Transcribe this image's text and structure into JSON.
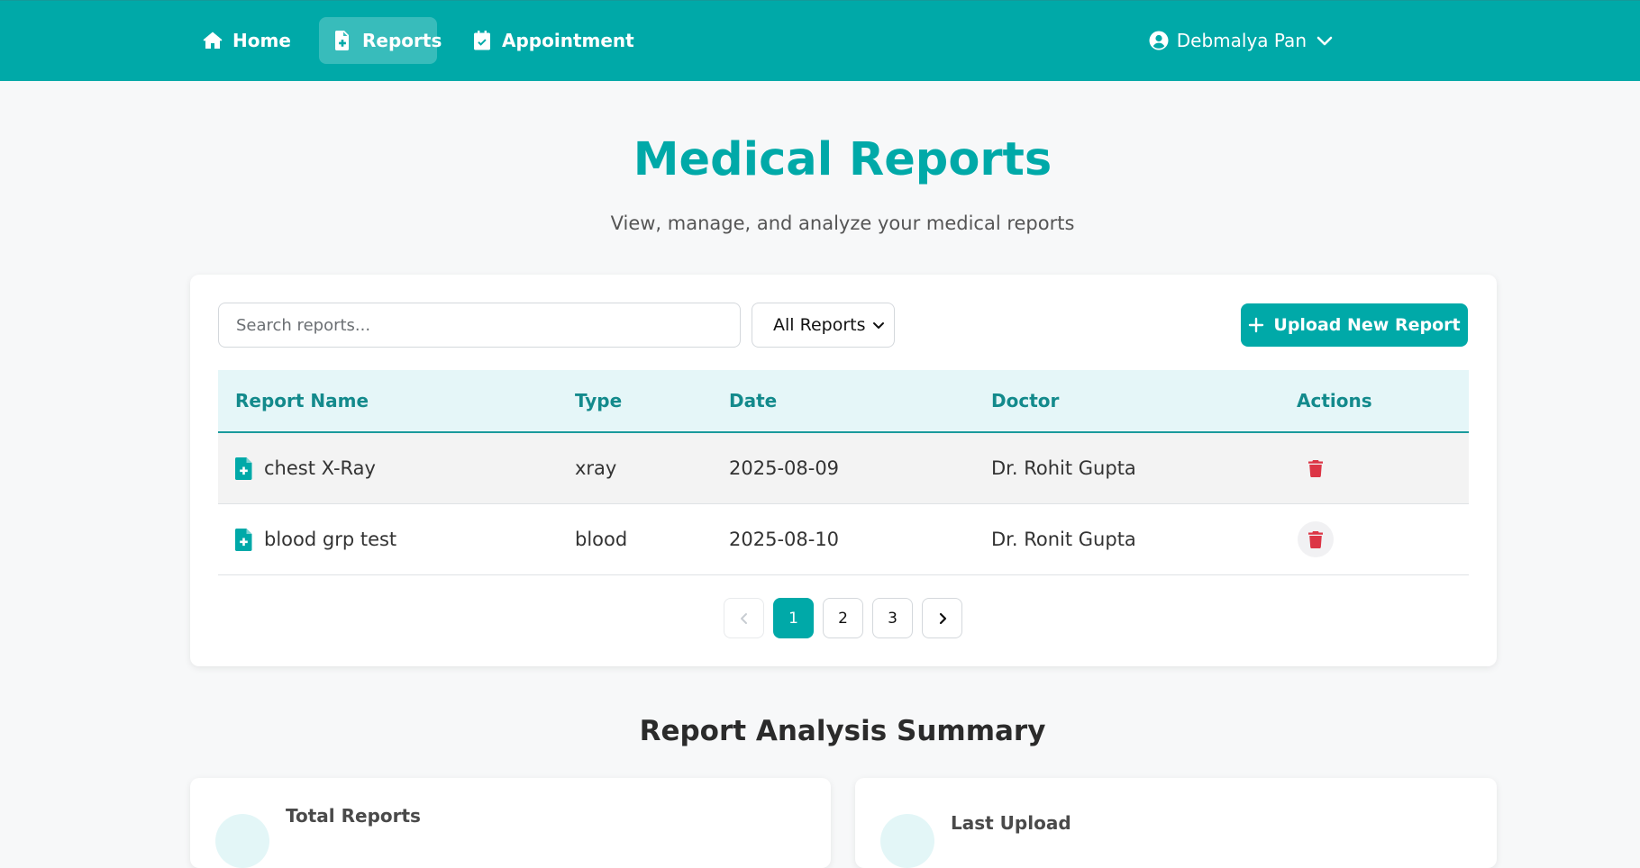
{
  "nav": {
    "items": [
      {
        "label": "Home",
        "icon": "home-icon"
      },
      {
        "label": "Reports",
        "icon": "file-medical-icon"
      },
      {
        "label": "Appointment",
        "icon": "calendar-check-icon"
      }
    ],
    "active": "Reports",
    "user_name": "Debmalya Pan"
  },
  "header": {
    "title": "Medical Reports",
    "subtitle": "View, manage, and analyze your medical reports"
  },
  "toolbar": {
    "search_placeholder": "Search reports...",
    "search_value": "",
    "filter_selected": "All Reports",
    "upload_label": "Upload New Report"
  },
  "table": {
    "columns": [
      "Report Name",
      "Type",
      "Date",
      "Doctor",
      "Actions"
    ],
    "rows": [
      {
        "name": "chest X-Ray",
        "type": "xray",
        "date": "2025-08-09",
        "doctor": "Dr. Rohit Gupta"
      },
      {
        "name": "blood grp test",
        "type": "blood",
        "date": "2025-08-10",
        "doctor": "Dr. Ronit Gupta"
      }
    ]
  },
  "pagination": {
    "pages": [
      "1",
      "2",
      "3"
    ],
    "current": "1"
  },
  "summary": {
    "title": "Report Analysis Summary",
    "cards": [
      {
        "label": "Total Reports"
      },
      {
        "label": "Last Upload"
      }
    ]
  },
  "colors": {
    "primary": "#00a9a8",
    "header_bg": "#e5f6f8",
    "header_text": "#138a8c",
    "danger": "#dc3545",
    "page_bg": "#f7f8f9"
  }
}
